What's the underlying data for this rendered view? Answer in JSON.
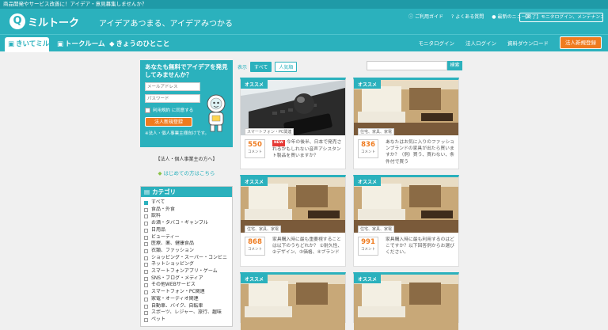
{
  "top_strip": "商品開発やサービス改善に！アイデア・意見募集しませんか？",
  "header": {
    "logo_text": "ミルトーク",
    "tagline": "アイデアあつまる、アイデアみつかる",
    "links": [
      {
        "icon": "info-icon",
        "label": "ご利用ガイド"
      },
      {
        "icon": "help-icon",
        "label": "よくある質問"
      },
      {
        "icon": "bell-icon",
        "label": "最新のニュース"
      }
    ],
    "notice": "【終了】モニタログイン、メンテナンスの…"
  },
  "nav": {
    "tabs": [
      {
        "icon": "chat-icon",
        "label": "きいてミル"
      },
      {
        "icon": "talk-icon",
        "label": "トークルーム"
      },
      {
        "icon": "bird-icon",
        "label": "きょうのひとこと"
      }
    ],
    "right": {
      "monitor_login": "モニタログイン",
      "corp_login": "法人ログイン",
      "download": "資料ダウンロード",
      "corp_register": "法人新規登録"
    }
  },
  "promo": {
    "title": "あなたも無料でアイデアを発見してみませんか？",
    "email_placeholder": "メールアドレス",
    "password_placeholder": "パスワード",
    "terms_label": "利用規約 に同意する",
    "register_button": "法人新規登録",
    "note": "※法人・個人事業主様向けです。",
    "corp_link": "【法人・個人事業主の方へ】",
    "first_link": "はじめての方はこちら"
  },
  "category": {
    "title": "カテゴリ",
    "items": [
      "すべて",
      "食品・外食",
      "飲料",
      "お酒・タバコ・ギャンブル",
      "日用品",
      "ビューティー",
      "医療、薬、健康食品",
      "衣類、ファッション",
      "ショッピング・スーパー・コンビニ",
      "ネットショッピング",
      "スマートフォンアプリ・ゲーム",
      "SNS・ブログ・メディア",
      "その他WEBサービス",
      "スマートフォン・PC関連",
      "家電・オーディオ関連",
      "自動車、バイク、自転車",
      "スポーツ、レジャー、旅行、趣味",
      "ペット"
    ]
  },
  "filter": {
    "label": "表示",
    "all": "すべて",
    "popular": "人気順"
  },
  "search": {
    "placeholder": "",
    "button": "検索"
  },
  "cards": [
    {
      "badge": "オススメ",
      "tag": "スマートフォン・PC関連",
      "count": "550",
      "unit": "コメント",
      "new": "NEW",
      "desc": "今年の後半、日本で発売されるかもしれない音声アシスタント製品を買いますか？"
    },
    {
      "badge": "オススメ",
      "tag": "住宅、家具、家電",
      "count": "836",
      "unit": "コメント",
      "new": "",
      "desc": "あなたはお気に入りのファッションブランドの家具が出たら買いますか？（例）買う、買わない、条件付で買う"
    },
    {
      "badge": "オススメ",
      "tag": "住宅、家具、家電",
      "count": "868",
      "unit": "コメント",
      "new": "",
      "desc": "家具購入時に最も重要視することは以下のうちどれか？ ①耐久性、②デザイン、③価格、④ブランド"
    },
    {
      "badge": "オススメ",
      "tag": "住宅、家具、家電",
      "count": "991",
      "unit": "コメント",
      "new": "",
      "desc": "家具購入時に最も利用するのはどこですか？以下回答例からお選びください。"
    },
    {
      "badge": "オススメ",
      "tag": "",
      "count": "",
      "unit": "",
      "new": "",
      "desc": ""
    },
    {
      "badge": "オススメ",
      "tag": "",
      "count": "",
      "unit": "",
      "new": "",
      "desc": ""
    }
  ],
  "colors": {
    "accent": "#2bb1bd",
    "orange": "#ef7b1f",
    "dark_teal": "#1f9aa7"
  }
}
